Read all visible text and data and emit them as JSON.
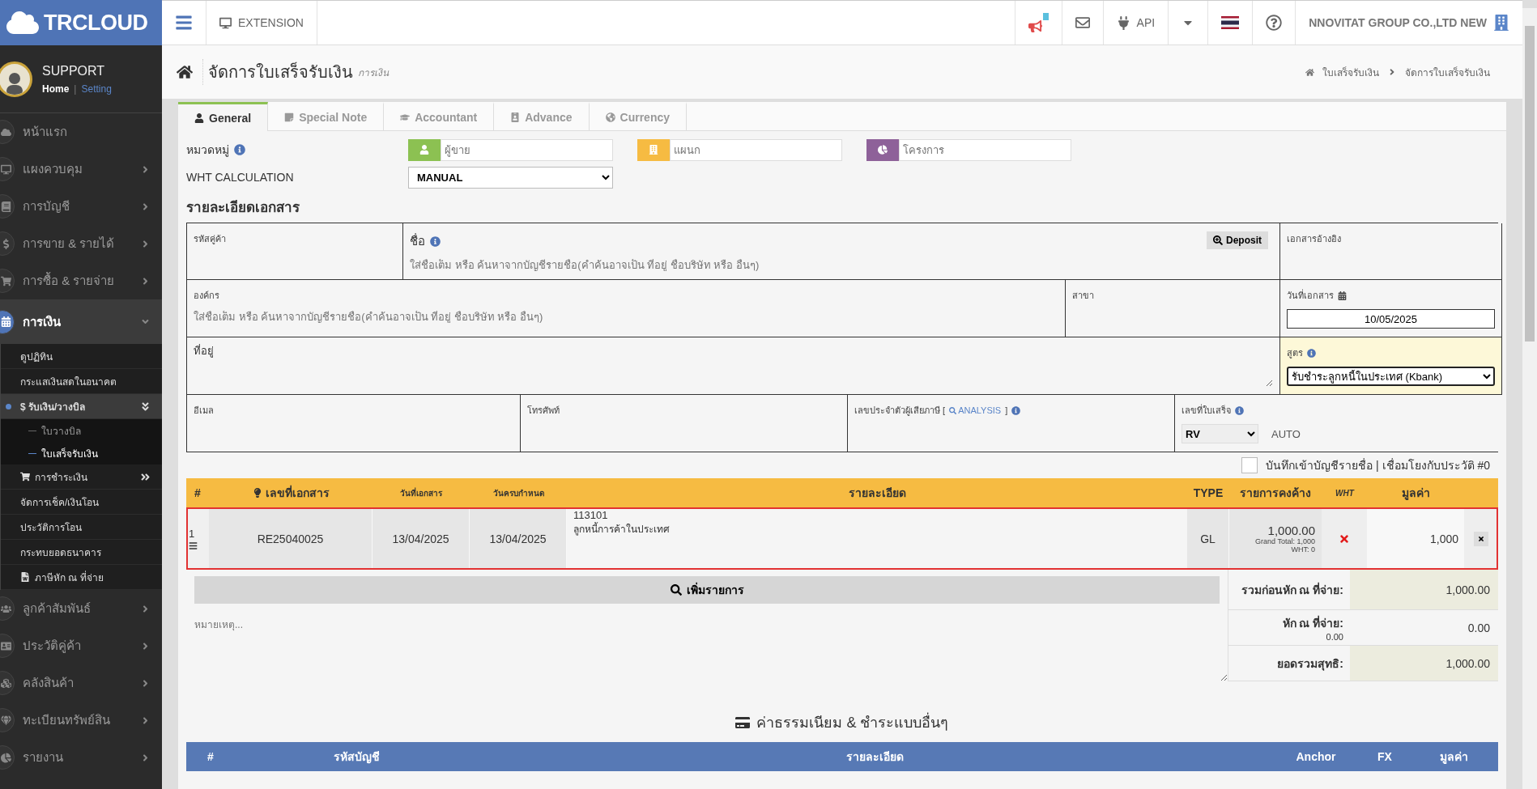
{
  "brand": "TRCLOUD",
  "user": {
    "name": "SUPPORT",
    "separator": "|",
    "links": [
      {
        "label": "Home",
        "selected": true
      },
      {
        "label": "Setting",
        "selected": false
      }
    ]
  },
  "sidebar": {
    "items": [
      {
        "label": "หน้าแรก"
      },
      {
        "label": "แผงควบคุม",
        "expanded": false
      },
      {
        "label": "การบัญชี",
        "expanded": false
      },
      {
        "label": "การขาย & รายได้",
        "expanded": false
      },
      {
        "label": "การซื้อ & รายจ่าย",
        "expanded": false
      },
      {
        "label": "การเงิน",
        "expanded": true,
        "children": [
          {
            "label": "ดูปฏิทิน"
          },
          {
            "label": "กระแสเงินสดในอนาคต"
          },
          {
            "label": "$ รับเงิน/วางบิล",
            "expanded": true,
            "children": [
              {
                "label": "ใบวางบิล",
                "selected": false
              },
              {
                "label": "ใบเสร็จรับเงิน",
                "selected": true
              }
            ]
          },
          {
            "label": "การชำระเงิน",
            "expanded": false
          },
          {
            "label": "จัดการเช็ค/เงินโอน"
          },
          {
            "label": "ประวัติการโอน"
          },
          {
            "label": "กระทบยอดธนาคาร"
          },
          {
            "label": "ภาษีหัก ณ ที่จ่าย"
          }
        ]
      },
      {
        "label": "ลูกค้าสัมพันธ์",
        "expanded": false
      },
      {
        "label": "ประวัติคู่ค้า",
        "expanded": false
      },
      {
        "label": "คลังสินค้า",
        "expanded": false
      },
      {
        "label": "ทะเบียนทรัพย์สิน",
        "expanded": false
      },
      {
        "label": "รายงาน",
        "expanded": false
      }
    ]
  },
  "topbar": {
    "extension": "EXTENSION",
    "api": "API",
    "company": "NNOVITAT GROUP CO.,LTD NEW"
  },
  "page": {
    "title": "จัดการใบเสร็จรับเงิน",
    "subtitle": "การเงิน",
    "breadcrumb": [
      "ใบเสร็จรับเงิน",
      "จัดการใบเสร็จรับเงิน"
    ]
  },
  "tabs": [
    {
      "label": "General",
      "selected": true
    },
    {
      "label": "Special Note",
      "selected": false
    },
    {
      "label": "Accountant",
      "selected": false
    },
    {
      "label": "Advance",
      "selected": false
    },
    {
      "label": "Currency",
      "selected": false
    }
  ],
  "category": {
    "label": "หมวดหมู่",
    "fields": [
      {
        "placeholder": "ผู้ขาย",
        "color": "#8cc152"
      },
      {
        "placeholder": "แผนก",
        "color": "#f6bb42"
      },
      {
        "placeholder": "โครงการ",
        "color": "#8e6199"
      }
    ]
  },
  "wht": {
    "label": "WHT CALCULATION",
    "value": "MANUAL"
  },
  "section_title": "รายละเอียดเอกสาร",
  "doc": {
    "customer_code_label": "รหัสคู่ค้า",
    "name": {
      "label": "ชื่อ",
      "placeholder": "ใส่ชื่อเต็ม หรือ ค้นหาจากบัญชีรายชื่อ(คำค้นอาจเป็น ที่อยู่ ชื่อบริษัท หรือ อื่นๆ)",
      "button": "Deposit"
    },
    "reference_label": "เอกสารอ้างอิง",
    "organization": {
      "label": "องค์กร",
      "placeholder": "ใส่ชื่อเต็ม หรือ ค้นหาจากบัญชีรายชื่อ(คำค้นอาจเป็น ที่อยู่ ชื่อบริษัท หรือ อื่นๆ)"
    },
    "branch_label": "สาขา",
    "doc_date": {
      "label": "วันที่เอกสาร",
      "value": "10/05/2025"
    },
    "address_label": "ที่อยู่",
    "formula": {
      "label": "สูตร",
      "value": "รับชำระลูกหนี้ในประเทศ (Kbank)"
    },
    "email_label": "อีเมล",
    "phone_label": "โทรศัพท์",
    "tax_id": {
      "label": "เลขประจำตัวผู้เสียภาษี [",
      "link": "ANALYSIS",
      "close": "]"
    },
    "receipt_no": {
      "label": "เลขที่ใบเสร็จ",
      "prefix": "RV",
      "mode": "AUTO"
    }
  },
  "ledger": {
    "label": "บันทึกเข้าบัญชีรายชื่อ | เชื่อมโยงกับประวัติ #0",
    "checked": false
  },
  "items": {
    "columns": [
      "#",
      "เลขที่เอกสาร",
      "วันที่เอกสาร",
      "วันครบกำหนด",
      "รายละเอียด",
      "TYPE",
      "รายการคงค้าง",
      "WHT",
      "มูลค่า"
    ],
    "rows": [
      {
        "no": "1",
        "doc_no": "RE25040025",
        "date": "13/04/2025",
        "due": "13/04/2025",
        "account": "113101",
        "description": "ลูกหนี้การค้าในประเทศ",
        "type": "GL",
        "outstanding": "1,000.00",
        "grand_total": "Grand Total: 1,000",
        "wht": "WHT: 0",
        "wht_applied": false,
        "value": "1,000",
        "highlighted": true
      }
    ],
    "add_button": "เพิ่มรายการ",
    "notes_placeholder": "หมายเหตุ...",
    "summary": [
      {
        "kind": "total",
        "label": "รวมก่อนหัก ณ ที่จ่าย:",
        "value": "1,000.00"
      },
      {
        "kind": "input",
        "label": "หัก ณ ที่จ่าย:",
        "sub": "0.00",
        "value": "0.00"
      },
      {
        "kind": "total",
        "label": "ยอดรวมสุทธิ:",
        "value": "1,000.00"
      }
    ]
  },
  "fees": {
    "title": "ค่าธรรมเนียม & ชำระแบบอื่นๆ",
    "columns": [
      "#",
      "รหัสบัญชี",
      "รายละเอียด",
      "Anchor",
      "FX",
      "มูลค่า"
    ]
  }
}
